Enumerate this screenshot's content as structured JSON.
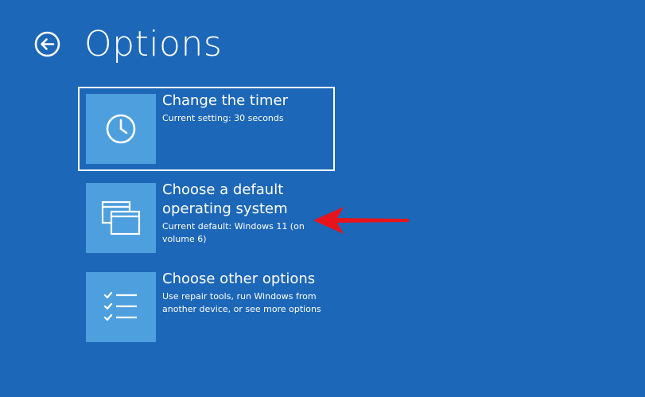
{
  "page": {
    "title": "Options",
    "back_icon": "back-arrow-icon"
  },
  "options": [
    {
      "label": "Change the timer",
      "description": "Current setting: 30 seconds",
      "icon": "clock-icon",
      "selected": true
    },
    {
      "label": "Choose a default operating system",
      "description": "Current default: Windows 11 (on volume 6)",
      "icon": "windows-icon",
      "selected": false
    },
    {
      "label": "Choose other options",
      "description": "Use repair tools, run Windows from another device, or see more options",
      "icon": "checklist-icon",
      "selected": false
    }
  ],
  "colors": {
    "background": "#1d67b8",
    "tile": "#4d9fdd",
    "annotation_arrow": "#e8141c"
  }
}
